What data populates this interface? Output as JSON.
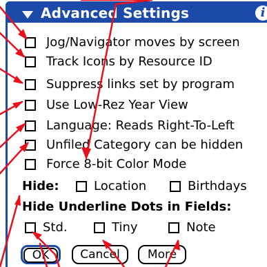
{
  "dialog": {
    "title": "Advanced Settings",
    "info_icon_glyph": "i"
  },
  "options": [
    {
      "label": "Jog/Navigator moves by screen",
      "checked": false
    },
    {
      "label": "Track Icons by Resource ID",
      "checked": false
    },
    {
      "label": "Suppress links set by program",
      "checked": false
    },
    {
      "label": "Use Low-Rez Year View",
      "checked": false
    },
    {
      "label": "Language: Reads Right-To-Left",
      "checked": false
    },
    {
      "label": "Unfiled Category can be hidden",
      "checked": false
    },
    {
      "label": "Force 8-bit Color Mode",
      "checked": false
    }
  ],
  "hide": {
    "label": "Hide:",
    "location_label": "Location",
    "birthdays_label": "Birthdays"
  },
  "underline": {
    "label": "Hide Underline Dots in Fields:",
    "std_label": "Std.",
    "tiny_label": "Tiny",
    "note_label": "Note"
  },
  "buttons": {
    "ok": "OK",
    "cancel": "Cancel",
    "more": "More"
  },
  "colors": {
    "title_bar": "#1b4aa8",
    "annotation": "#e8101a"
  },
  "icons": {
    "title_arrow": "triangle-down-icon",
    "info": "info-icon"
  }
}
